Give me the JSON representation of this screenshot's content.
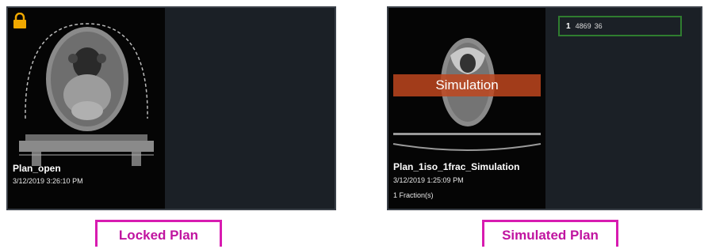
{
  "locked_card": {
    "plan_name": "Plan_open",
    "plan_date": "3/12/2019 3:26:10 PM",
    "icon": "lock-icon"
  },
  "simulated_card": {
    "plan_name": "Plan_1iso_1frac_Simulation",
    "plan_date": "3/12/2019 1:25:09 PM",
    "fraction_text": "1 Fraction(s)",
    "banner_text": "Simulation",
    "field": {
      "index": "1",
      "value1": "4869",
      "value2": "36"
    }
  },
  "captions": {
    "locked": "Locked Plan",
    "simulated": "Simulated Plan"
  },
  "colors": {
    "lock": "#f0a800",
    "banner": "#be461e",
    "field_border": "#2f7d2f",
    "caption": "#d81bb0"
  }
}
